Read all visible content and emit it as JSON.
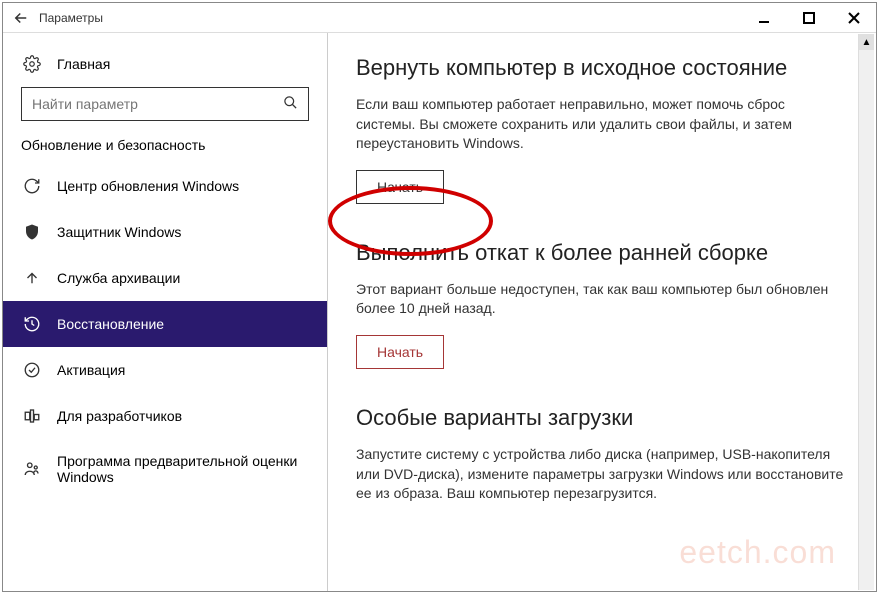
{
  "titlebar": {
    "title": "Параметры"
  },
  "sidebar": {
    "home": "Главная",
    "search_placeholder": "Найти параметр",
    "section_label": "Обновление и безопасность",
    "items": [
      {
        "label": "Центр обновления Windows",
        "icon": "refresh"
      },
      {
        "label": "Защитник Windows",
        "icon": "shield"
      },
      {
        "label": "Служба архивации",
        "icon": "upload"
      },
      {
        "label": "Восстановление",
        "icon": "history"
      },
      {
        "label": "Активация",
        "icon": "check-circle"
      },
      {
        "label": "Для разработчиков",
        "icon": "code"
      },
      {
        "label": "Программа предварительной оценки Windows",
        "icon": "insider"
      }
    ]
  },
  "main": {
    "reset": {
      "title": "Вернуть компьютер в исходное состояние",
      "desc": "Если ваш компьютер работает неправильно, может помочь сброс системы. Вы сможете сохранить или удалить свои файлы, и затем переустановить Windows.",
      "button": "Начать"
    },
    "rollback": {
      "title": "Выполнить откат к более ранней сборке",
      "desc": "Этот вариант больше недоступен, так как ваш компьютер был обновлен более 10 дней назад.",
      "button": "Начать"
    },
    "advanced": {
      "title": "Особые варианты загрузки",
      "desc": "Запустите систему с устройства либо диска (например, USB-накопителя или DVD-диска), измените параметры загрузки Windows или восстановите ее из образа. Ваш компьютер перезагрузится."
    }
  },
  "watermark": "eetch.com"
}
